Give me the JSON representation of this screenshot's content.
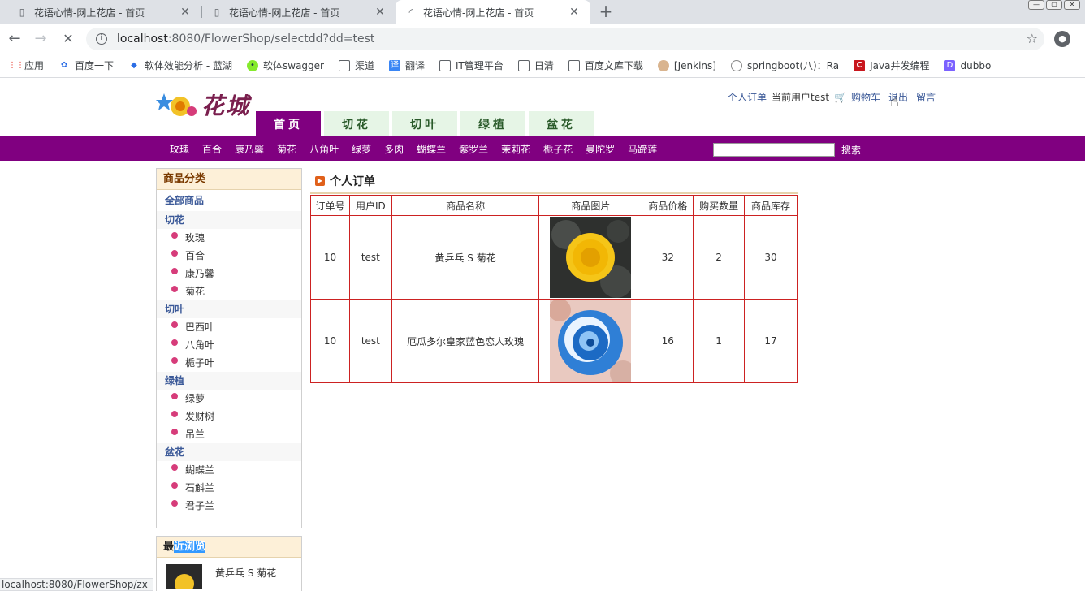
{
  "browser": {
    "tabs": [
      {
        "title": "花语心情-网上花店 - 首页",
        "active": false
      },
      {
        "title": "花语心情-网上花店 - 首页",
        "active": false
      },
      {
        "title": "花语心情-网上花店 - 首页",
        "active": true
      }
    ],
    "url_host": "localhost",
    "url_rest": ":8080/FlowerShop/selectdd?dd=test",
    "bookmarks": [
      {
        "label": "应用",
        "icon": "apps-grid-icon"
      },
      {
        "label": "百度一下",
        "icon": "baidu-paw-icon"
      },
      {
        "label": "软体效能分析 - 蓝湖",
        "icon": "lanhu-icon"
      },
      {
        "label": "软体swagger",
        "icon": "swagger-icon"
      },
      {
        "label": "渠道",
        "icon": "page-icon"
      },
      {
        "label": "翻译",
        "icon": "translate-icon"
      },
      {
        "label": "IT管理平台",
        "icon": "page-icon"
      },
      {
        "label": "日清",
        "icon": "page-icon"
      },
      {
        "label": "百度文库下载",
        "icon": "page-icon"
      },
      {
        "label": "[Jenkins]",
        "icon": "jenkins-icon"
      },
      {
        "label": "springboot(八)：Ra",
        "icon": "spring-icon"
      },
      {
        "label": "Java并发编程",
        "icon": "csdn-icon"
      },
      {
        "label": "dubbo",
        "icon": "dubbo-icon"
      }
    ],
    "status_url": "localhost:8080/FlowerShop/zx"
  },
  "site": {
    "logo_text": "花城",
    "toplinks": {
      "orders": "个人订单",
      "current_user": "当前用户test",
      "cart": "购物车",
      "logout": "退出",
      "message": "留言"
    },
    "main_tabs": [
      {
        "label": "首页",
        "active": true
      },
      {
        "label": "切花",
        "active": false
      },
      {
        "label": "切叶",
        "active": false
      },
      {
        "label": "绿植",
        "active": false
      },
      {
        "label": "盆花",
        "active": false
      }
    ],
    "categories": [
      "玫瑰",
      "百合",
      "康乃馨",
      "菊花",
      "八角叶",
      "绿萝",
      "多肉",
      "蝴蝶兰",
      "紫罗兰",
      "茉莉花",
      "栀子花",
      "曼陀罗",
      "马蹄莲"
    ],
    "search_button": "搜索"
  },
  "sidebar": {
    "title": "商品分类",
    "all": "全部商品",
    "groups": [
      {
        "name": "切花",
        "items": [
          "玫瑰",
          "百合",
          "康乃馨",
          "菊花"
        ]
      },
      {
        "name": "切叶",
        "items": [
          "巴西叶",
          "八角叶",
          "栀子叶"
        ]
      },
      {
        "name": "绿植",
        "items": [
          "绿萝",
          "发财树",
          "吊兰"
        ]
      },
      {
        "name": "盆花",
        "items": [
          "蝴蝶兰",
          "石斛兰",
          "君子兰"
        ]
      }
    ]
  },
  "recent": {
    "title_a": "最",
    "title_b": "近浏览",
    "item": "黄乒乓 S 菊花"
  },
  "orders": {
    "title": "个人订单",
    "headers": [
      "订单号",
      "用户ID",
      "商品名称",
      "商品图片",
      "商品价格",
      "购买数量",
      "商品库存"
    ],
    "rows": [
      {
        "id": "10",
        "user": "test",
        "name": "黄乒乓 S 菊花",
        "image": "yellow-chrysanthemum",
        "price": "32",
        "qty": "2",
        "stock": "30"
      },
      {
        "id": "10",
        "user": "test",
        "name": "厄瓜多尔皇家蓝色恋人玫瑰",
        "image": "blue-rose",
        "price": "16",
        "qty": "1",
        "stock": "17"
      }
    ]
  }
}
